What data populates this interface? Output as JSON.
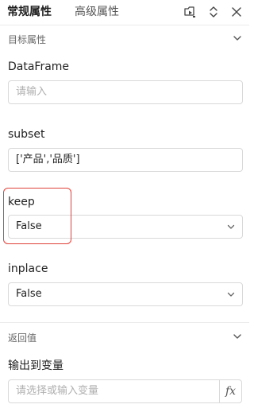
{
  "tabs": [
    {
      "label": "常规属性",
      "active": true
    },
    {
      "label": "高级属性",
      "active": false
    }
  ],
  "toolbar": {
    "icons": [
      "flow-run-icon",
      "expand-collapse-icon",
      "close-icon"
    ]
  },
  "sections": {
    "target": {
      "title": "目标属性"
    },
    "return": {
      "title": "返回值"
    }
  },
  "fields": {
    "dataframe": {
      "label": "DataFrame",
      "placeholder": "请输入"
    },
    "subset": {
      "label": "subset",
      "value": "['产品','品质']"
    },
    "keep": {
      "label": "keep",
      "value": "False"
    },
    "inplace": {
      "label": "inplace",
      "value": "False"
    },
    "output": {
      "label": "输出到变量",
      "placeholder": "请选择或输入变量",
      "fx_label": "fx"
    }
  },
  "colors": {
    "highlight": "#e0413a",
    "border": "#d9d9d9",
    "placeholder": "#b0b0b0"
  }
}
